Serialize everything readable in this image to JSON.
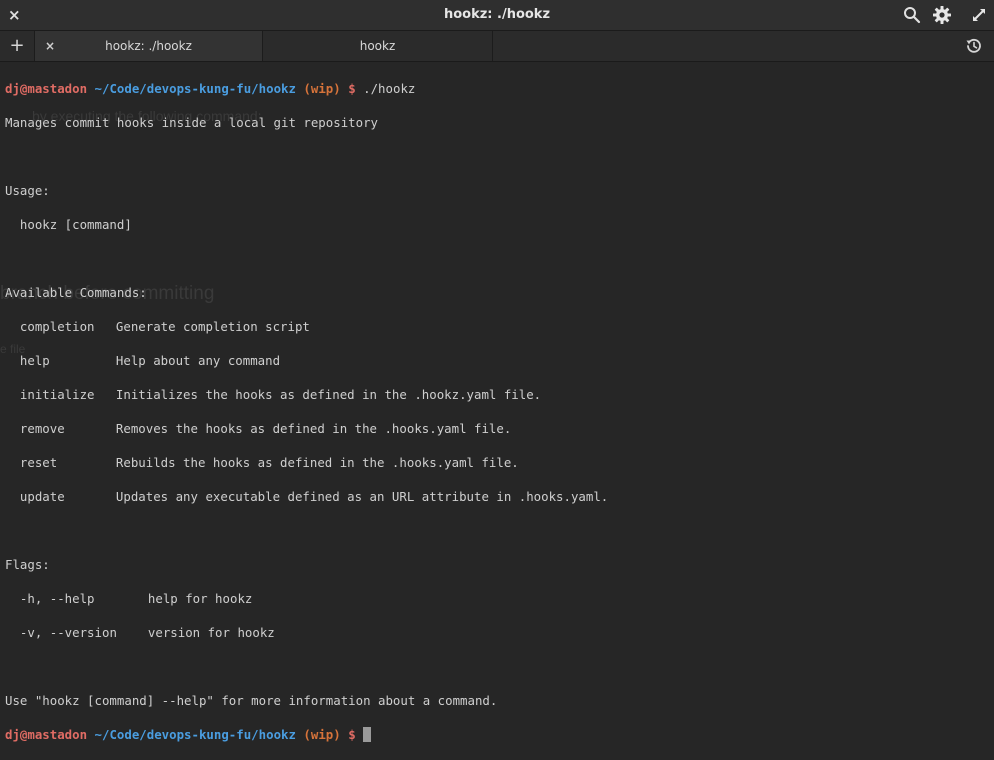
{
  "window": {
    "title": "hookz: ./hookz",
    "close_glyph": "×"
  },
  "tabs": {
    "new_glyph": "+",
    "close_glyph": "×",
    "items": [
      {
        "label": "hookz: ./hookz"
      },
      {
        "label": "hookz"
      }
    ]
  },
  "prompt": {
    "user_host": "dj@mastadon",
    "path": "~/Code/devops-kung-fu/hookz",
    "branch": "(wip)",
    "symbol": "$"
  },
  "terminal": {
    "command": "./hookz",
    "description": "Manages commit hooks inside a local git repository",
    "usage_header": "Usage:",
    "usage_line": "  hookz [command]",
    "commands_header": "Available Commands:",
    "commands": [
      {
        "name": "completion",
        "desc": "Generate completion script"
      },
      {
        "name": "help",
        "desc": "Help about any command"
      },
      {
        "name": "initialize",
        "desc": "Initializes the hooks as defined in the .hookz.yaml file."
      },
      {
        "name": "remove",
        "desc": "Removes the hooks as defined in the .hooks.yaml file."
      },
      {
        "name": "reset",
        "desc": "Rebuilds the hooks as defined in the .hooks.yaml file."
      },
      {
        "name": "update",
        "desc": "Updates any executable defined as an URL attribute in .hooks.yaml."
      }
    ],
    "flags_header": "Flags:",
    "flags": [
      {
        "name": "-h, --help",
        "desc": "help for hookz"
      },
      {
        "name": "-v, --version",
        "desc": "version for hookz"
      }
    ],
    "footer": "Use \"hookz [command] --help\" for more information about a command."
  },
  "ghost_text": {
    "line1": "by executing the following command:",
    "line2": "branch before committing",
    "line3": "e file"
  },
  "colors": {
    "background": "#262626",
    "user": "#e06c64",
    "path": "#4a9de0",
    "branch": "#d6733a"
  }
}
